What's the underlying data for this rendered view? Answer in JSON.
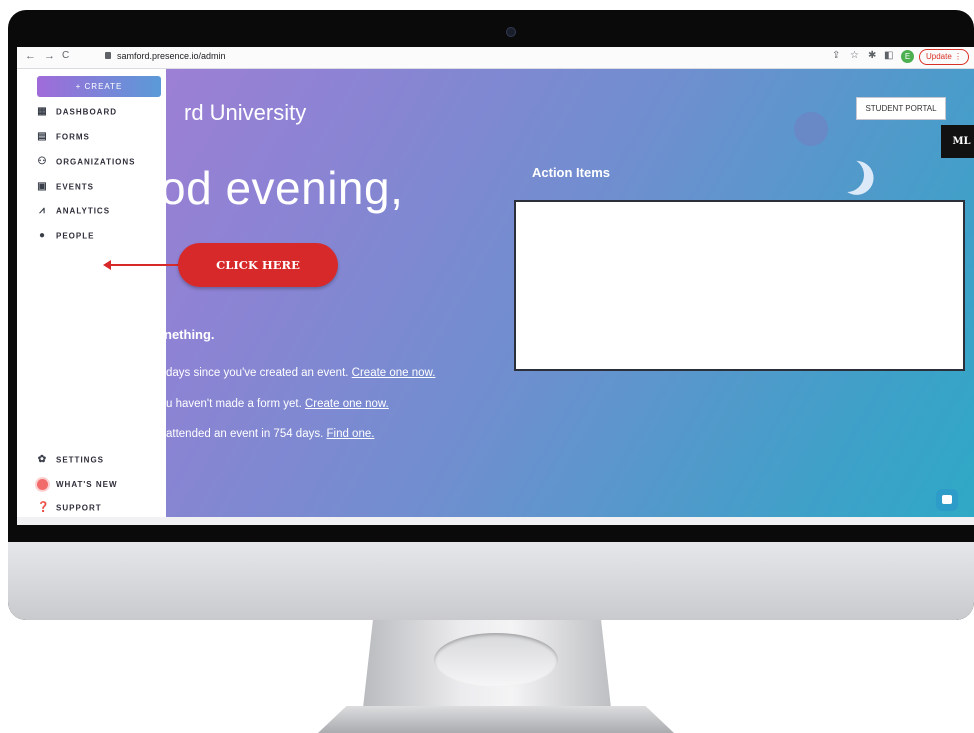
{
  "browser": {
    "url": "samford.presence.io/admin",
    "update_label": "Update",
    "profile_initial": "E"
  },
  "sidebar": {
    "create_label": "+   CREATE",
    "items": [
      {
        "label": "DASHBOARD",
        "icon": "grid-icon"
      },
      {
        "label": "FORMS",
        "icon": "document-icon"
      },
      {
        "label": "ORGANIZATIONS",
        "icon": "group-icon"
      },
      {
        "label": "EVENTS",
        "icon": "calendar-icon"
      },
      {
        "label": "ANALYTICS",
        "icon": "chart-icon"
      },
      {
        "label": "PEOPLE",
        "icon": "person-icon"
      }
    ],
    "bottom_items": [
      {
        "label": "SETTINGS",
        "icon": "gear-icon"
      },
      {
        "label": "WHAT'S NEW",
        "icon": "notification-icon"
      },
      {
        "label": "SUPPORT",
        "icon": "help-icon"
      }
    ]
  },
  "main": {
    "university": "rd University",
    "greeting": "od evening,",
    "something": "nething.",
    "line1_text": "days since you've created an event. ",
    "line1_link": "Create one now.",
    "line2_text": "u haven't made a form yet. ",
    "line2_link": "Create one now.",
    "line3_text": "attended an event in 754 days. ",
    "line3_link": "Find one.",
    "action_items_title": "Action Items",
    "student_portal": "STUDENT PORTAL",
    "badge": "ML"
  },
  "callout": {
    "label": "CLICK HERE"
  },
  "colors": {
    "callout": "#d8292a",
    "gradient_start": "#a97ed6",
    "gradient_end": "#2ea9c6"
  }
}
